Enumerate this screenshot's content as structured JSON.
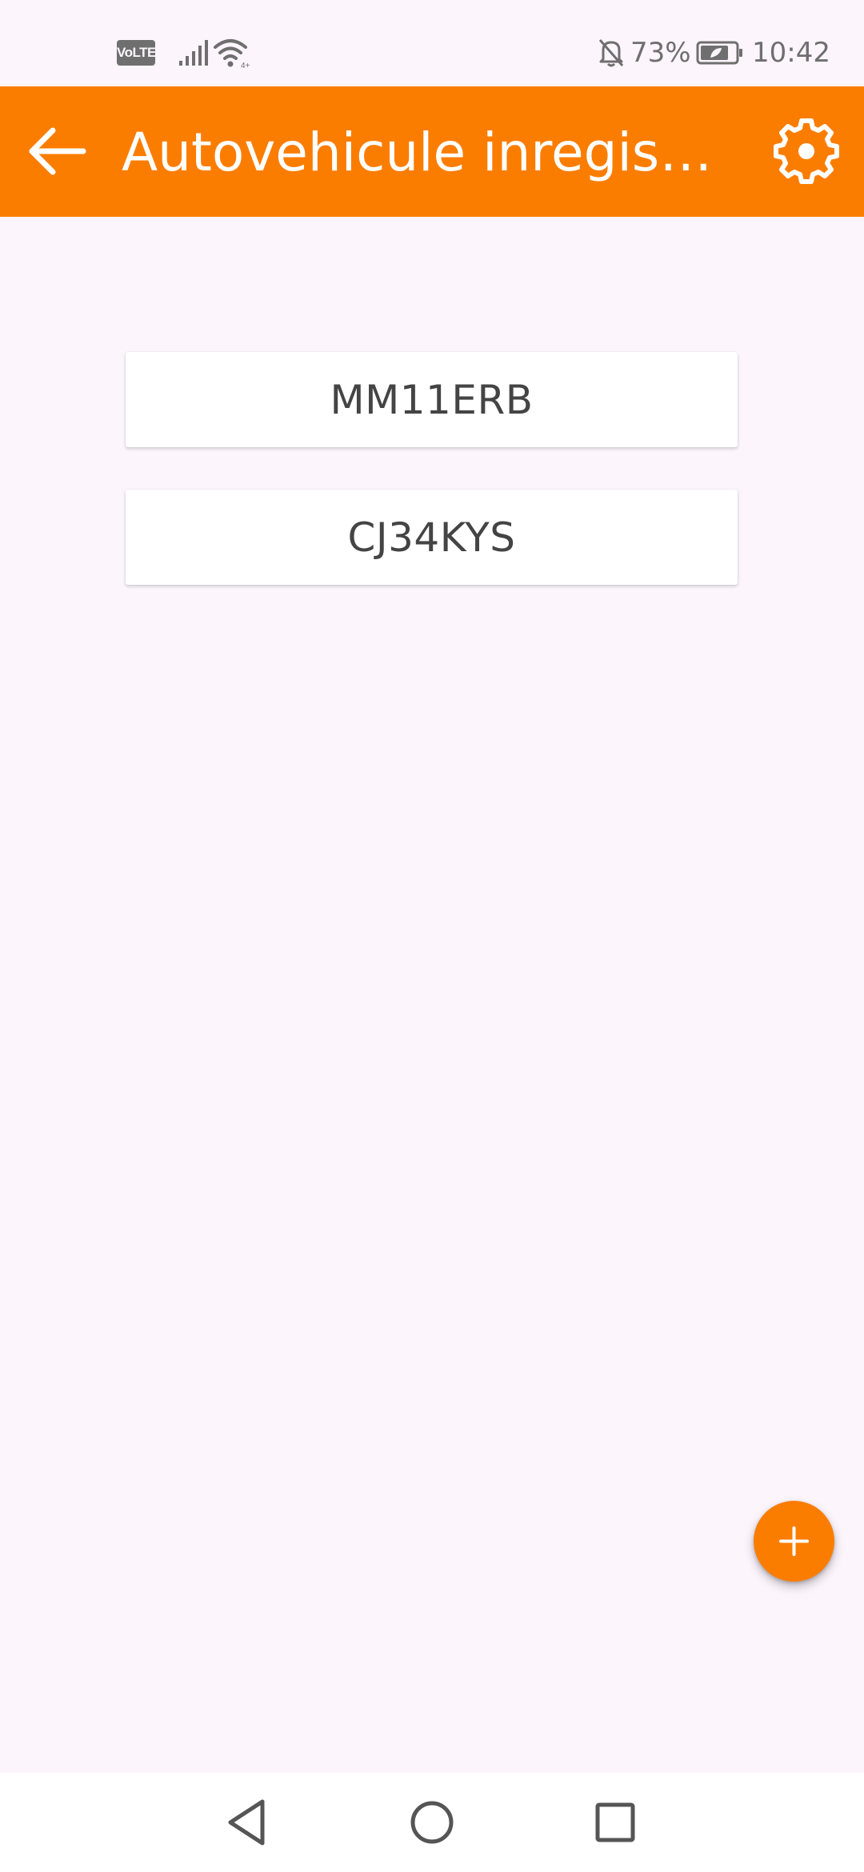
{
  "status_bar": {
    "volte_label": "VoLTE",
    "battery_percent": "73%",
    "time": "10:42",
    "icons": [
      "signal-icon",
      "wifi-icon",
      "mute-icon",
      "battery-icon"
    ]
  },
  "app_bar": {
    "title": "Autovehicule inregistr...",
    "back_icon": "arrow-left-icon",
    "settings_icon": "gear-icon",
    "background_color": "#fb7d00"
  },
  "vehicles": [
    {
      "plate": "MM11ERB"
    },
    {
      "plate": "CJ34KYS"
    }
  ],
  "fab": {
    "icon": "plus-icon",
    "color": "#fb7d00"
  },
  "nav_bar": {
    "buttons": [
      "triangle-back-icon",
      "circle-home-icon",
      "square-recents-icon"
    ]
  }
}
